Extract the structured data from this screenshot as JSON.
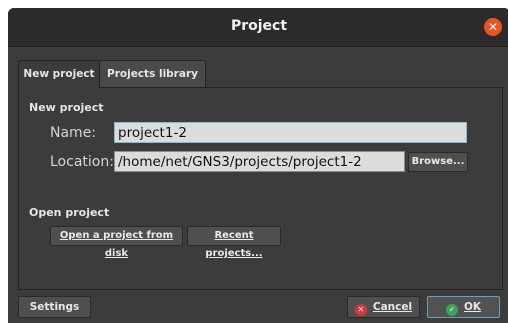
{
  "window": {
    "title": "Project"
  },
  "tabs": {
    "new_project": "New project",
    "projects_library": "Projects library"
  },
  "new_project": {
    "heading": "New project",
    "name_label": "Name:",
    "name_value": "project1-2",
    "location_label": "Location:",
    "location_value": "/home/net/GNS3/projects/project1-2",
    "browse_label": "Browse..."
  },
  "open_project": {
    "heading": "Open project",
    "open_from_disk_label": "Open a project from disk",
    "recent_projects_label": "Recent projects..."
  },
  "footer": {
    "settings_label": "Settings",
    "cancel_label": "Cancel",
    "ok_label": "OK"
  },
  "colors": {
    "close": "#e95420",
    "cancel_icon": "#d13a3a",
    "ok_icon": "#3aa35c"
  }
}
